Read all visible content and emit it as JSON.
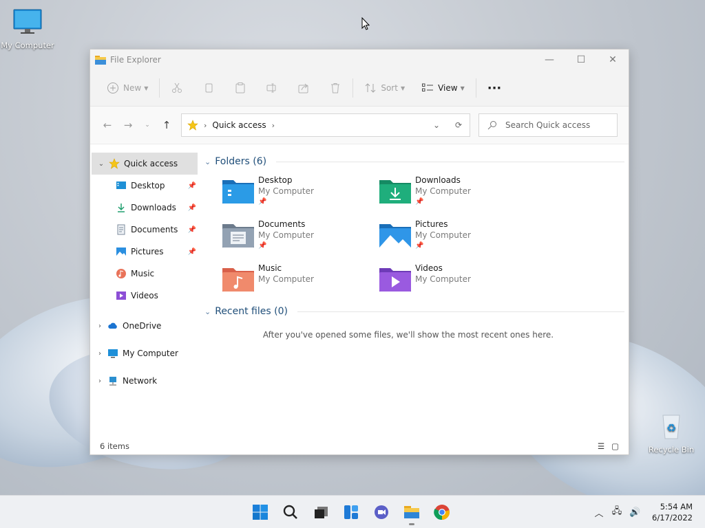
{
  "desktop": {
    "icons": [
      {
        "label": "My Computer",
        "icon": "monitor-icon"
      },
      {
        "label": "Recycle Bin",
        "icon": "recycle-bin-icon"
      }
    ]
  },
  "window": {
    "title": "File Explorer",
    "controls": {
      "minimize": "—",
      "maximize": "☐",
      "close": "✕"
    },
    "commands": {
      "new": "New",
      "sort": "Sort",
      "view": "View",
      "more": "···"
    },
    "address": {
      "crumb": "Quick access",
      "search_placeholder": "Search Quick access"
    },
    "sidebar": {
      "quick_access": "Quick access",
      "pinned": [
        {
          "label": "Desktop",
          "icon": "desktop-icon",
          "pinned": true
        },
        {
          "label": "Downloads",
          "icon": "downloads-icon",
          "pinned": true
        },
        {
          "label": "Documents",
          "icon": "documents-icon",
          "pinned": true
        },
        {
          "label": "Pictures",
          "icon": "pictures-icon",
          "pinned": true
        },
        {
          "label": "Music",
          "icon": "music-icon",
          "pinned": false
        },
        {
          "label": "Videos",
          "icon": "videos-icon",
          "pinned": false
        }
      ],
      "roots": [
        {
          "label": "OneDrive",
          "icon": "cloud-icon"
        },
        {
          "label": "My Computer",
          "icon": "monitor-icon"
        },
        {
          "label": "Network",
          "icon": "network-icon"
        }
      ]
    },
    "folders_header": "Folders (6)",
    "folders": [
      {
        "name": "Desktop",
        "location": "My Computer",
        "pinned": true,
        "icon": "desktop-folder-icon"
      },
      {
        "name": "Downloads",
        "location": "My Computer",
        "pinned": true,
        "icon": "downloads-folder-icon"
      },
      {
        "name": "Documents",
        "location": "My Computer",
        "pinned": true,
        "icon": "documents-folder-icon"
      },
      {
        "name": "Pictures",
        "location": "My Computer",
        "pinned": true,
        "icon": "pictures-folder-icon"
      },
      {
        "name": "Music",
        "location": "My Computer",
        "pinned": false,
        "icon": "music-folder-icon"
      },
      {
        "name": "Videos",
        "location": "My Computer",
        "pinned": false,
        "icon": "videos-folder-icon"
      }
    ],
    "recent_header": "Recent files (0)",
    "recent_empty": "After you've opened some files, we'll show the most recent ones here.",
    "status": "6 items"
  },
  "taskbar": {
    "apps": [
      "start-icon",
      "search-icon",
      "task-view-icon",
      "widgets-icon",
      "chat-icon",
      "file-explorer-icon",
      "chrome-icon"
    ],
    "clock_time": "5:54 AM",
    "clock_date": "6/17/2022"
  }
}
